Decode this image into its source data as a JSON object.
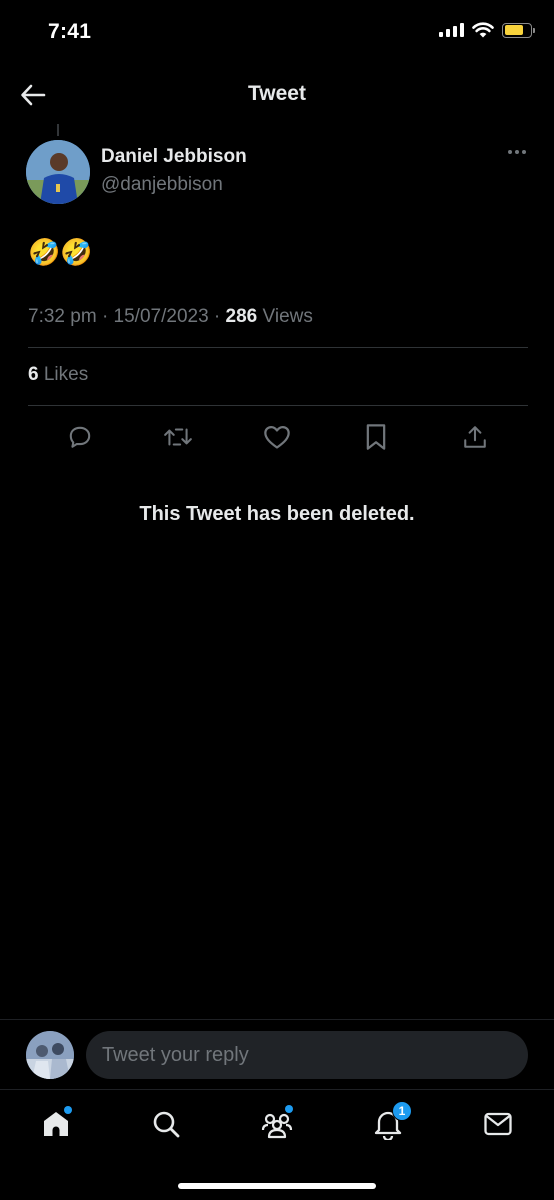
{
  "status_bar": {
    "time": "7:41",
    "icons": [
      "cellular-signal-icon",
      "wifi-icon",
      "battery-icon"
    ],
    "battery_level": 0.75,
    "battery_color": "#f7d23c"
  },
  "header": {
    "title": "Tweet",
    "back_icon": "arrow-left-icon"
  },
  "tweet": {
    "author_name": "Daniel Jebbison",
    "author_handle": "@danjebbison",
    "text": "🤣🤣",
    "time": "7:32 pm",
    "separator": "·",
    "date": "15/07/2023",
    "views_count": "286",
    "views_label": "Views",
    "likes_count": "6",
    "likes_label": "Likes",
    "actions": [
      "reply-icon",
      "retweet-icon",
      "like-icon",
      "bookmark-icon",
      "share-icon"
    ]
  },
  "deleted_notice": "This Tweet has been deleted.",
  "reply": {
    "placeholder": "Tweet your reply"
  },
  "bottom_nav": {
    "items": [
      "home-icon",
      "search-icon",
      "communities-icon",
      "notifications-icon",
      "messages-icon"
    ],
    "notifications_badge": "1"
  },
  "colors": {
    "background": "#000000",
    "primary_text": "#e7e9ea",
    "secondary_text": "#71767b",
    "accent": "#1d9bf0",
    "divider": "#2f3336"
  }
}
